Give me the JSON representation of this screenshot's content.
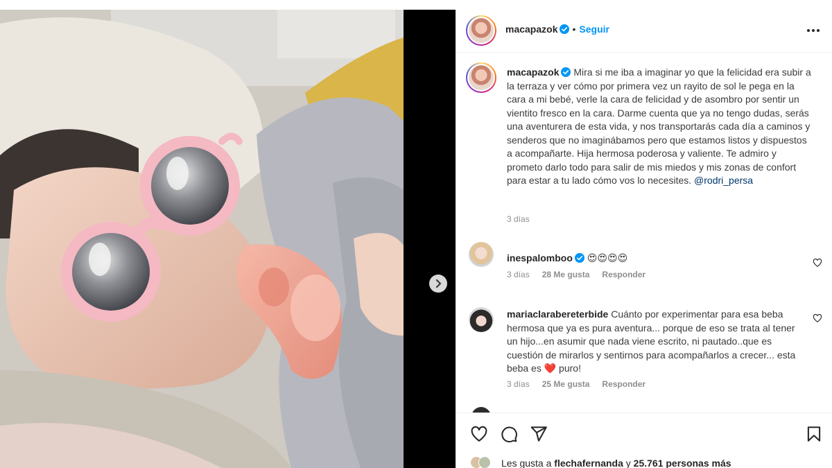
{
  "post": {
    "username": "macapazok",
    "follow_label": "Seguir",
    "separator": "•"
  },
  "caption": {
    "username": "macapazok",
    "text": "Mira si me iba a imaginar yo que la felicidad era subir a la terraza y ver cómo por primera vez un rayito de sol le pega en la cara a mi bebé, verle la cara de felicidad y de asombro por sentir un vientito fresco en la cara. Darme cuenta que ya no tengo dudas, serás una aventurera de esta vida, y nos transportarás cada día a caminos y senderos que no imaginábamos pero que estamos listos y dispuestos a acompañarte. Hija hermosa poderosa y valiente. Te admiro y prometo darlo todo para salir de mis miedos y mis zonas de confort para estar a tu lado cómo vos lo necesites. ",
    "mention": "@rodri_persa",
    "time": "3 días"
  },
  "comments": [
    {
      "username": "inespalomboo",
      "text": "😍😍😍😍",
      "time": "3 días",
      "likes": "28 Me gusta",
      "reply": "Responder"
    },
    {
      "username": "mariaclarabereterbide",
      "text_before": "Cuánto por experimentar para esa beba hermosa que ya es pura aventura... porque de eso se trata al tener un hijo...en asumir que nada viene escrito, ni pautado..que es cuestión de mirarlos y sentirnos para acompañarlos a crecer... esta beba es ",
      "emoji": "❤️",
      "text_after": " puro!",
      "time": "3 días",
      "likes": "25 Me gusta",
      "reply": "Responder"
    }
  ],
  "likes": {
    "prefix": "Les gusta a ",
    "user": "flechafernanda",
    "middle": " y ",
    "count": "25.761 personas más"
  },
  "icons": [
    "verified-icon",
    "more-icon",
    "heart-icon",
    "comment-icon",
    "share-icon",
    "bookmark-icon",
    "chevron-right-icon"
  ],
  "colors": {
    "link": "#0095f6",
    "mention": "#00376b",
    "muted": "#8e8e8e",
    "verified": "#0095f6"
  }
}
